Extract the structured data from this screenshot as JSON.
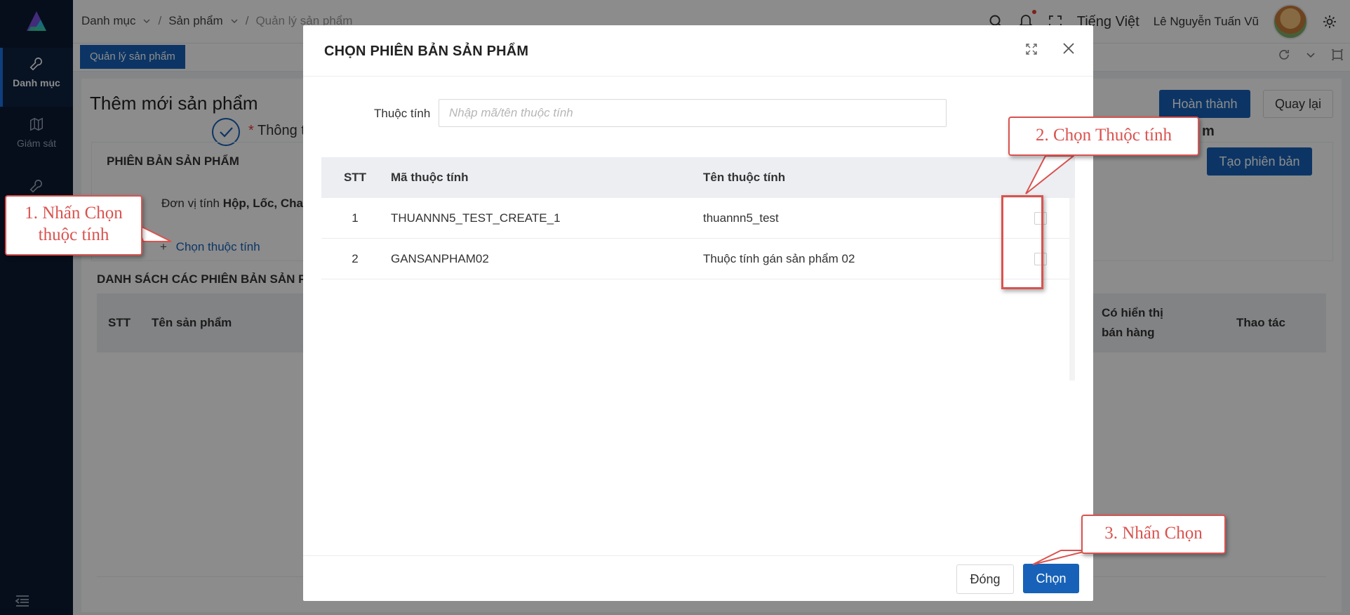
{
  "sidebar": {
    "items": [
      {
        "label": "Danh mục",
        "icon": "wrench-icon"
      },
      {
        "label": "Giám sát",
        "icon": "map-icon"
      },
      {
        "label": "",
        "icon": "wrench-icon"
      }
    ]
  },
  "header": {
    "breadcrumb": [
      "Danh mục",
      "Sản phẩm",
      "Quản lý sản phẩm"
    ],
    "language": "Tiếng Việt",
    "user_name": "Lê Nguyễn Tuấn Vũ"
  },
  "tabs": {
    "active": "Quản lý sản phẩm"
  },
  "page": {
    "title": "Thêm mới sản phẩm",
    "complete_button": "Hoàn thành",
    "back_button": "Quay lại",
    "create_version_button": "Tạo phiên bản",
    "step_label_prefix": "* ",
    "step_label": "Thông t",
    "step_label_tail": "m",
    "section_title": "PHIÊN BẢN SẢN PHẨM",
    "unit_label": "Đơn vị tính",
    "unit_values": "Hộp, Lốc, Cha",
    "add_attribute_link": "Chọn thuộc tính",
    "list_title": "DANH SÁCH CÁC PHIÊN BẢN SẢN P",
    "list_columns": {
      "stt": "STT",
      "name": "Tên sản phẩm",
      "show_sale_line1": "Có hiển thị",
      "show_sale_line2": "bán hàng",
      "actions": "Thao tác"
    }
  },
  "modal": {
    "title": "CHỌN PHIÊN BẢN SẢN PHẨM",
    "filter_label": "Thuộc tính",
    "filter_placeholder": "Nhập mã/tên thuộc tính",
    "filter_value": "",
    "columns": {
      "stt": "STT",
      "code": "Mã thuộc tính",
      "name": "Tên thuộc tính"
    },
    "rows": [
      {
        "stt": "1",
        "code": "THUANNN5_TEST_CREATE_1",
        "name": "thuannn5_test",
        "checked": false
      },
      {
        "stt": "2",
        "code": "GANSANPHAM02",
        "name": "Thuộc tính gán sản phẩm 02",
        "checked": false
      }
    ],
    "close_button": "Đóng",
    "choose_button": "Chọn"
  },
  "annotations": {
    "step1_line1": "1. Nhấn Chọn",
    "step1_line2": "thuộc tính",
    "step2": "2. Chọn Thuộc tính",
    "step3": "3. Nhấn Chọn"
  },
  "colors": {
    "primary": "#1762b8",
    "sidebar_bg": "#0b1b33",
    "annotation_red": "#d9534f"
  }
}
